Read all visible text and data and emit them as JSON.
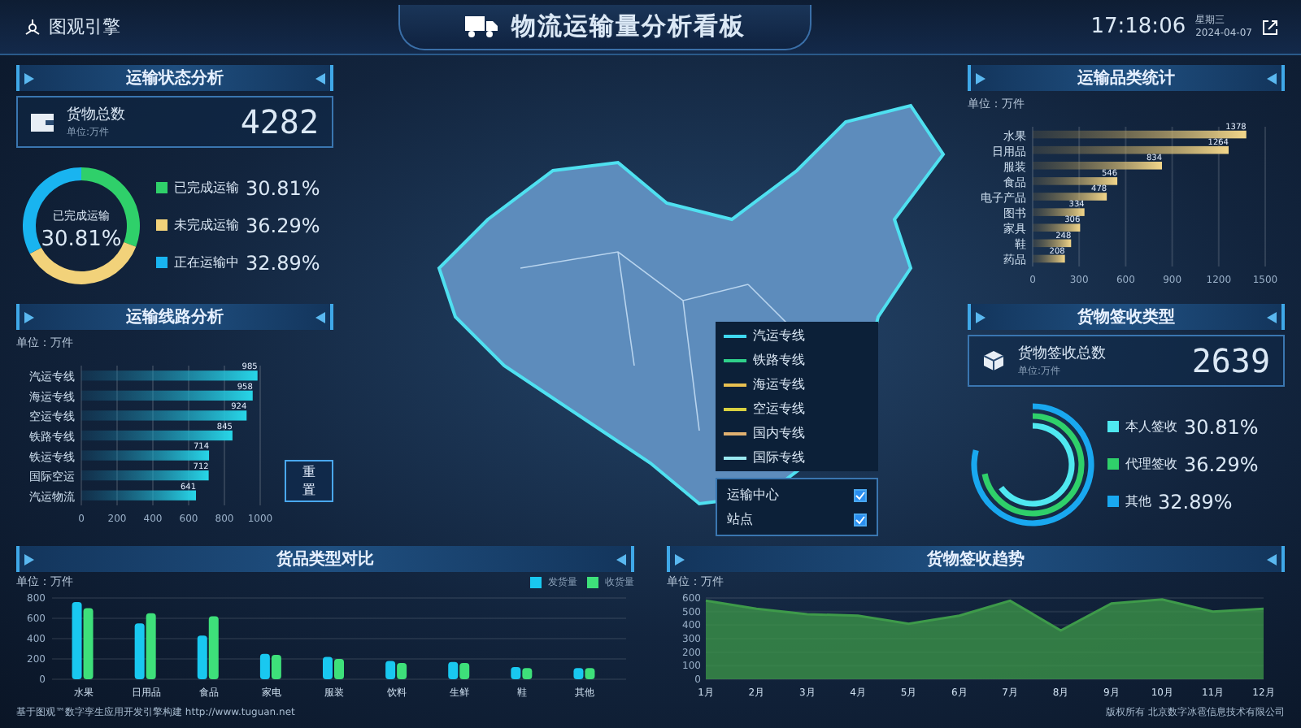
{
  "header": {
    "logo": "图观引擎",
    "title": "物流运输量分析看板",
    "time": "17:18:06",
    "weekday": "星期三",
    "date": "2024-04-07"
  },
  "status_panel": {
    "title": "运输状态分析",
    "card": {
      "label": "货物总数",
      "unit": "单位:万件",
      "value": "4282"
    },
    "donut_label": "已完成运输",
    "donut_value": "30.81%",
    "legend": [
      {
        "value": "30.81%",
        "color": "#2fd06a"
      },
      {
        "value": "36.29%",
        "color": "#f2d27a"
      },
      {
        "value": "32.89%",
        "color": "#19b4f0"
      }
    ],
    "chart_data": {
      "type": "donut",
      "categories": [
        "已完成运输",
        "未完成运输",
        "正在运输中"
      ],
      "values": [
        30.81,
        36.29,
        32.89
      ]
    }
  },
  "route_panel": {
    "title": "运输线路分析",
    "unit": "单位：万件",
    "reset_button": "重置",
    "chart_data": {
      "type": "bar",
      "orientation": "horizontal",
      "grid": true,
      "categories": [
        "汽运专线",
        "海运专线",
        "空运专线",
        "铁路专线",
        "铁运专线",
        "国际空运",
        "汽运物流"
      ],
      "values": [
        985,
        958,
        924,
        845,
        714,
        712,
        641
      ],
      "xlim": [
        0,
        1000
      ],
      "xticks": [
        0,
        200,
        400,
        600,
        800,
        1000
      ],
      "data_labels": true
    }
  },
  "map": {
    "layers": [
      {
        "label": "运输中心",
        "checked": true
      },
      {
        "label": "站点",
        "checked": true
      }
    ],
    "lines": [
      {
        "label": "汽运专线",
        "color": "#3fd8f0"
      },
      {
        "label": "铁路专线",
        "color": "#2fd08a"
      },
      {
        "label": "海运专线",
        "color": "#e8c050"
      },
      {
        "label": "空运专线",
        "color": "#d8d040"
      },
      {
        "label": "国内专线",
        "color": "#e0b070"
      },
      {
        "label": "国际专线",
        "color": "#9ae8f0"
      }
    ]
  },
  "category_panel": {
    "title": "运输品类统计",
    "unit": "单位：万件",
    "chart_data": {
      "type": "bar",
      "orientation": "horizontal",
      "grid": true,
      "categories": [
        "水果",
        "日用品",
        "服装",
        "食品",
        "电子产品",
        "图书",
        "家具",
        "鞋",
        "药品"
      ],
      "values": [
        1378,
        1264,
        834,
        546,
        478,
        334,
        306,
        248,
        208
      ],
      "xlim": [
        0,
        1500
      ],
      "xticks": [
        0,
        300,
        600,
        900,
        1200,
        1500
      ],
      "data_labels": true
    }
  },
  "sign_panel": {
    "title": "货物签收类型",
    "card": {
      "label": "货物签收总数",
      "unit": "单位:万件",
      "value": "2639"
    },
    "legend": [
      {
        "label": "本人签收",
        "value": "30.81%",
        "color": "#4fe8f0"
      },
      {
        "label": "代理签收",
        "value": "36.29%",
        "color": "#2fd06a"
      },
      {
        "label": "其他",
        "value": "32.89%",
        "color": "#19a8f0"
      }
    ]
  },
  "compare_panel": {
    "title": "货品类型对比",
    "unit": "单位：万件",
    "chart_data": {
      "type": "bar",
      "orientation": "vertical",
      "grid": true,
      "categories": [
        "水果",
        "日用品",
        "食品",
        "家电",
        "服装",
        "饮料",
        "生鲜",
        "鞋",
        "其他"
      ],
      "series": [
        {
          "name": "发货量",
          "color": "#19c8f0",
          "values": [
            760,
            550,
            430,
            250,
            220,
            180,
            170,
            120,
            110
          ]
        },
        {
          "name": "收货量",
          "color": "#3ee07a",
          "values": [
            700,
            650,
            620,
            240,
            200,
            160,
            160,
            110,
            110
          ]
        }
      ],
      "ylim": [
        0,
        800
      ],
      "yticks": [
        0,
        200,
        400,
        600,
        800
      ]
    }
  },
  "trend_panel": {
    "title": "货物签收趋势",
    "unit": "单位：万件",
    "chart_data": {
      "type": "area",
      "grid": true,
      "categories": [
        "1月",
        "2月",
        "3月",
        "4月",
        "5月",
        "6月",
        "7月",
        "8月",
        "9月",
        "10月",
        "11月",
        "12月"
      ],
      "series": [
        {
          "color": "#3e9a4a",
          "values": [
            580,
            520,
            480,
            470,
            410,
            470,
            580,
            360,
            560,
            590,
            500,
            520
          ]
        }
      ],
      "ylim": [
        0,
        600
      ],
      "yticks": [
        0,
        100,
        200,
        300,
        400,
        500,
        600
      ]
    }
  },
  "footer": {
    "left": "基于图观™数字孪生应用开发引擎构建 http://www.tuguan.net",
    "right": "版权所有 北京数字冰雹信息技术有限公司"
  }
}
